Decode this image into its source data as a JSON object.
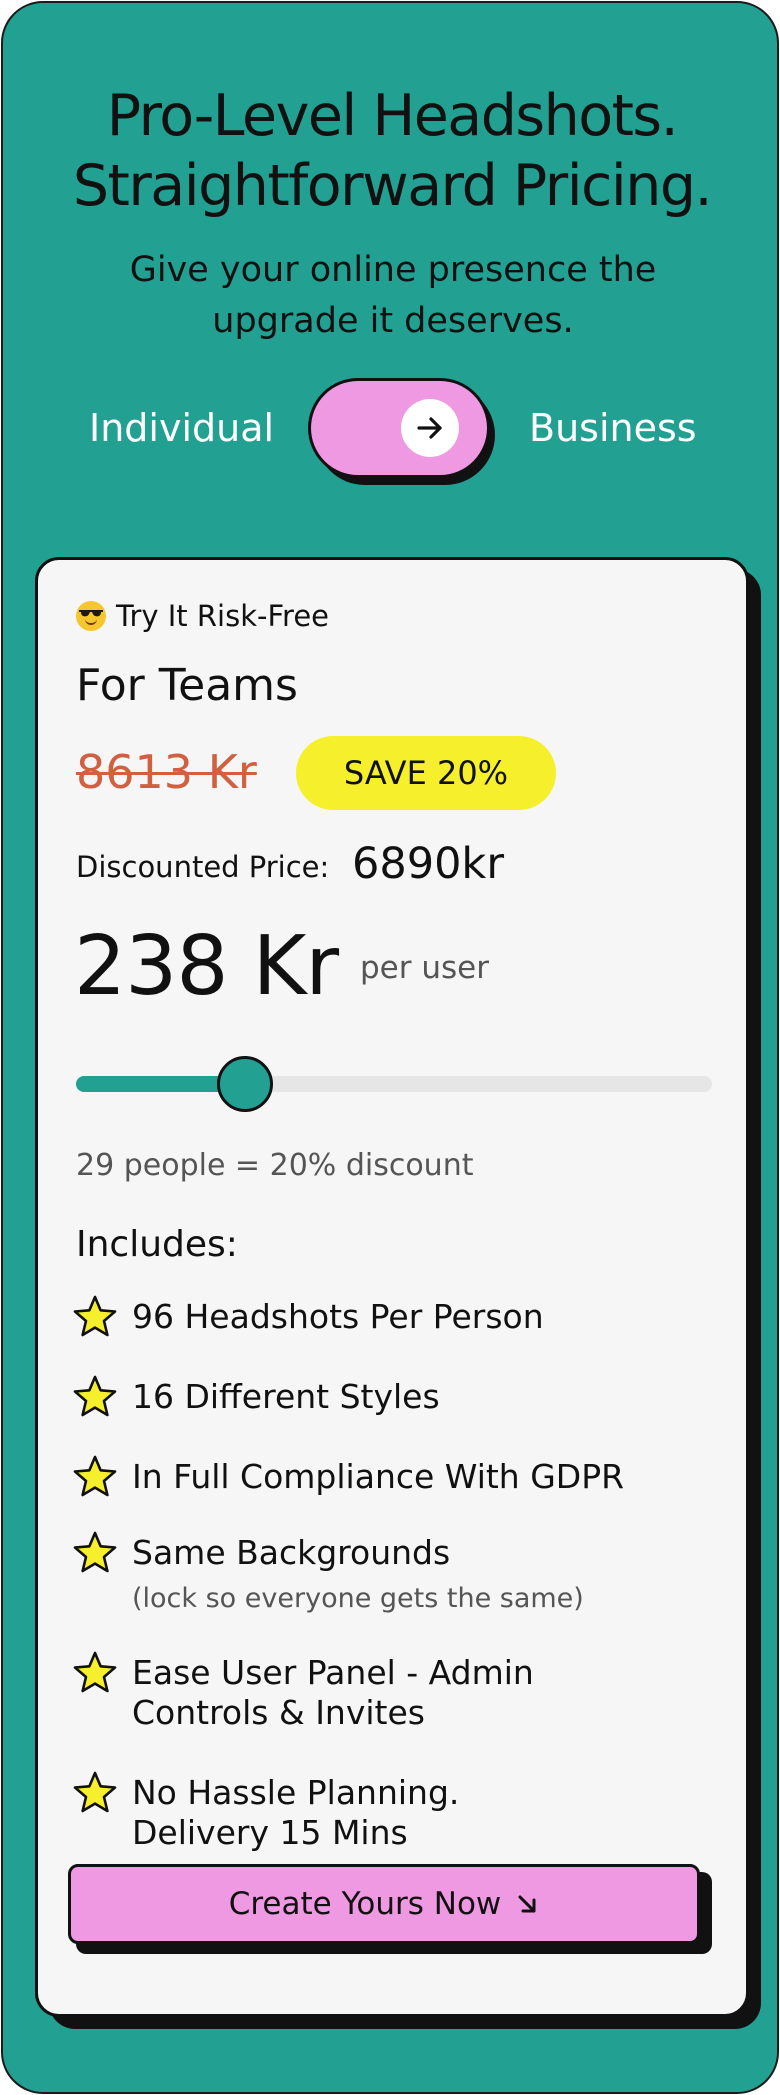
{
  "hero": {
    "title_line1": "Pro-Level Headshots.",
    "title_line2": "Straightforward Pricing.",
    "subtitle_line1": "Give your online presence the",
    "subtitle_line2": "upgrade it deserves."
  },
  "toggle": {
    "left_label": "Individual",
    "right_label": "Business",
    "selected": "Business",
    "icon": "arrow-right-icon"
  },
  "card": {
    "risk_label": "Try It Risk-Free",
    "risk_icon": "sunglasses-emoji-icon",
    "plan_title": "For Teams",
    "original_price": "8613 Kr",
    "save_badge": "SAVE 20%",
    "discounted_label": "Discounted Price:",
    "discounted_value": "6890kr",
    "per_user_price": "238 Kr",
    "per_user_label": "per user",
    "slider": {
      "value_fraction": 0.265
    },
    "discount_summary": "29 people = 20% discount",
    "includes_label": "Includes:",
    "features": [
      {
        "text": "96 Headshots Per Person"
      },
      {
        "text": "16 Different Styles"
      },
      {
        "text": "In Full Compliance With GDPR"
      },
      {
        "text": "Same Backgrounds",
        "sub": "(lock so everyone gets the same)"
      },
      {
        "line1": "Ease User Panel - Admin",
        "line2": "Controls & Invites"
      },
      {
        "line1": "No Hassle Planning.",
        "line2": "Delivery 15 Mins"
      }
    ],
    "cta_label": "Create Yours Now",
    "cta_icon": "arrow-down-right-icon"
  },
  "colors": {
    "background_teal": "#22a193",
    "toggle_pink": "#ee99e2",
    "badge_yellow": "#f5ef2c",
    "strike_orange": "#d0603f",
    "star_yellow": "#f5ef2c"
  }
}
